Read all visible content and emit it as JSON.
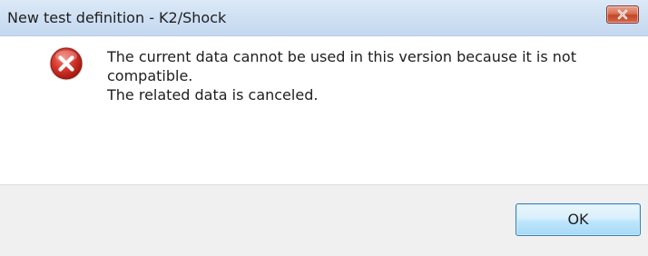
{
  "window": {
    "title": "New test definition - K2/Shock"
  },
  "titlebar_buttons": {
    "close_icon": "close-icon"
  },
  "message": {
    "icon": "error-icon",
    "lines": [
      "The current data cannot be used in this version because it is not",
      "compatible.",
      "The related data is canceled."
    ]
  },
  "footer": {
    "ok_label": "OK"
  },
  "colors": {
    "error_red": "#c8251d",
    "close_button_red": "#d9704f",
    "button_border_blue": "#3c7fb1",
    "footer_gray": "#f0f0f0"
  }
}
